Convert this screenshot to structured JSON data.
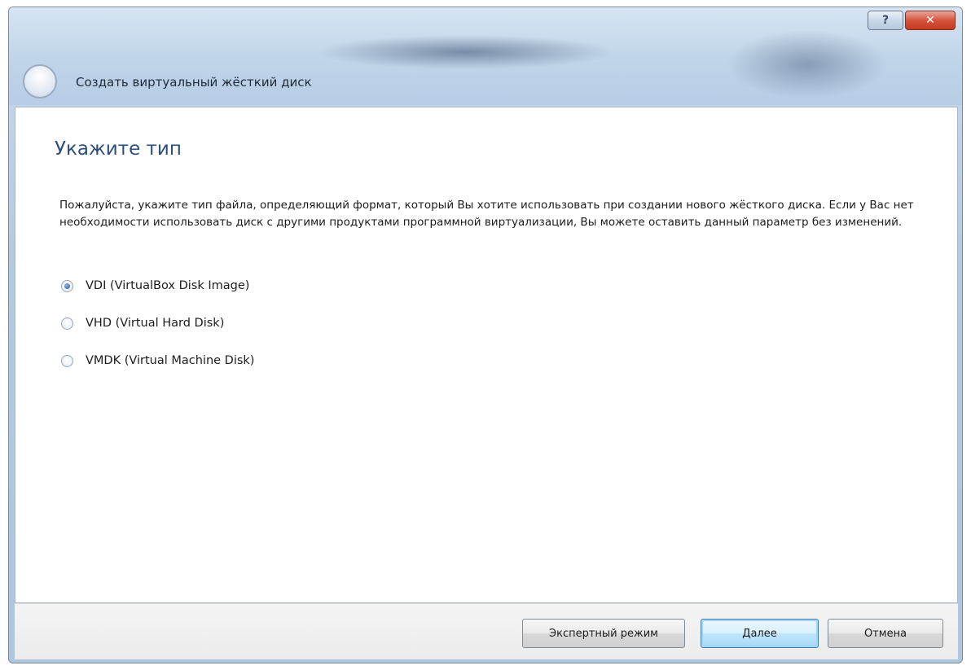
{
  "window": {
    "title": "Создать виртуальный жёсткий диск",
    "help_label": "?",
    "close_label": "✕"
  },
  "page": {
    "heading": "Укажите тип",
    "description": "Пожалуйста, укажите тип файла, определяющий формат, который Вы хотите использовать при создании нового жёсткого диска. Если у Вас нет необходимости использовать диск с другими продуктами программной виртуализации, Вы можете оставить данный параметр без изменений."
  },
  "options": [
    {
      "label": "VDI (VirtualBox Disk Image)",
      "checked": true
    },
    {
      "label": "VHD (Virtual Hard Disk)",
      "checked": false
    },
    {
      "label": "VMDK (Virtual Machine Disk)",
      "checked": false
    }
  ],
  "buttons": {
    "expert": "Экспертный режим",
    "next": "Далее",
    "cancel": "Отмена"
  },
  "icons": {
    "back": "back-arrow-orb-icon",
    "help": "help-icon",
    "close": "close-icon"
  },
  "colors": {
    "heading": "#2b4e7c",
    "close_button": "#c43a22",
    "default_button_border": "#3c7fb1"
  }
}
